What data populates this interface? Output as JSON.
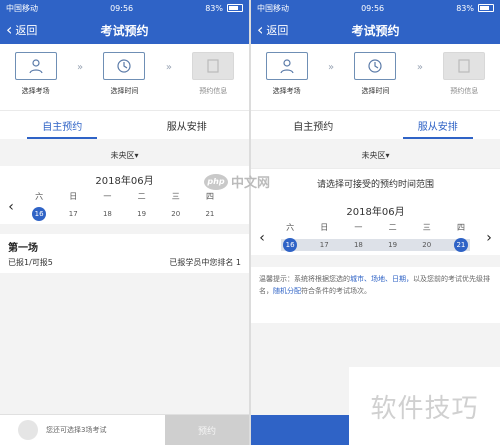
{
  "status_bar": {
    "carrier": "中国移动",
    "time": "09:56",
    "battery": "83%"
  },
  "nav": {
    "back_label": "返回",
    "title": "考试预约"
  },
  "steps": [
    {
      "label": "选择考场",
      "icon": "person-icon"
    },
    {
      "label": "选择时间",
      "icon": "clock-icon"
    },
    {
      "label": "预约信息",
      "icon": "document-icon"
    }
  ],
  "tabs": [
    {
      "label": "自主预约"
    },
    {
      "label": "服从安排"
    }
  ],
  "region": "未央区▾",
  "calendar": {
    "month": "2018年06月",
    "weekdays": [
      "六",
      "日",
      "一",
      "二",
      "三",
      "四"
    ],
    "days": [
      "16",
      "17",
      "18",
      "19",
      "20",
      "21"
    ]
  },
  "left": {
    "session_title": "第一场",
    "booked": "已报1/可报5",
    "rank": "已报学员中您排名 1",
    "footer_text": "您还可选择3场考试",
    "footer_button": "预约"
  },
  "right": {
    "prompt": "请选择可接受的预约时间范围",
    "notice_prefix": "温馨提示：系统将根据您选的",
    "notice_kw1": "城市、场地、日期，",
    "notice_mid": "以及您前的考试优先级排名，",
    "notice_kw2": "随机分配",
    "notice_suffix": "符合条件的考试场次。"
  },
  "watermark": {
    "logo": "php",
    "text": "中文网"
  },
  "corner_watermark": "软件技巧",
  "colors": {
    "primary": "#2f63c6",
    "background": "#f3f3f3",
    "inactive": "#cfcfcf"
  }
}
